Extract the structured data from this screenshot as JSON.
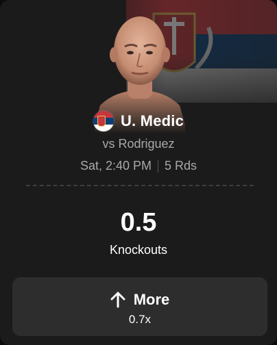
{
  "fighter": {
    "name": "U. Medic",
    "opponent_line": "vs Rodriguez",
    "country_flag": "serbia-flag"
  },
  "event": {
    "time": "Sat, 2:40 PM",
    "rounds": "5 Rds"
  },
  "stat": {
    "value": "0.5",
    "label": "Knockouts"
  },
  "action": {
    "label": "More",
    "odds": "0.7x",
    "icon": "arrow-up-icon"
  },
  "colors": {
    "card_bg": "#1b1b1b",
    "button_bg": "#2d2d2d",
    "muted_text": "#a9a9a9",
    "flag_red": "#c6363c",
    "flag_blue": "#0c4076",
    "flag_white": "#ffffff"
  }
}
